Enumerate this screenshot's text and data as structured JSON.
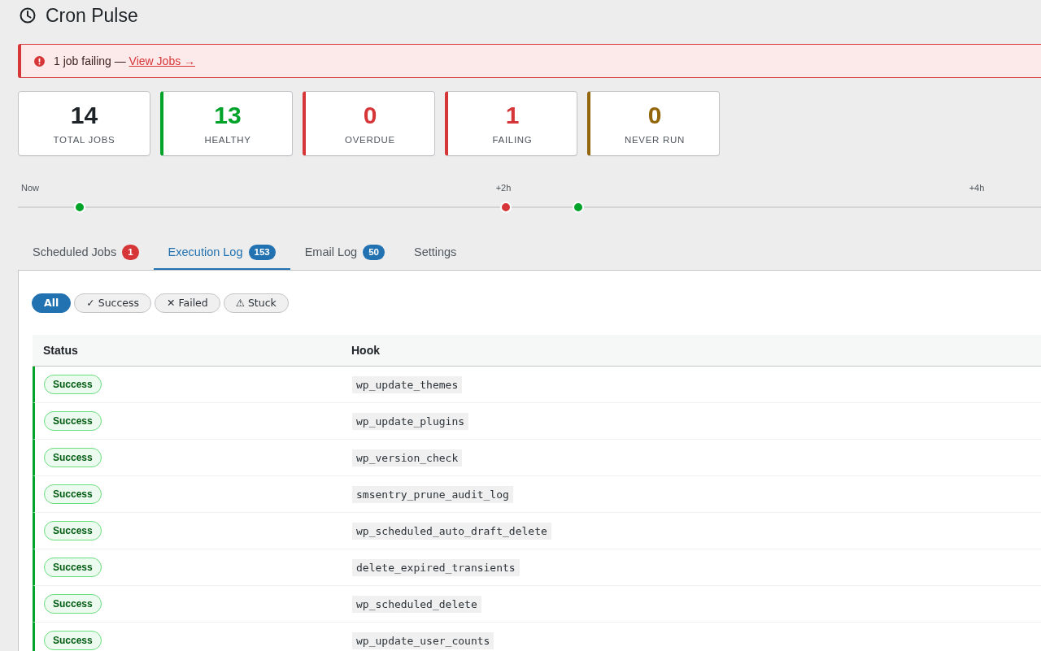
{
  "header": {
    "title": "Cron Pulse"
  },
  "alert": {
    "message": "1 job failing —",
    "link": "View Jobs →"
  },
  "stats": [
    {
      "value": "14",
      "label": "TOTAL JOBS"
    },
    {
      "value": "13",
      "label": "HEALTHY",
      "color": "#00a32a"
    },
    {
      "value": "0",
      "label": "OVERDUE",
      "color": "#d63638"
    },
    {
      "value": "1",
      "label": "FAILING",
      "color": "#d63638"
    },
    {
      "value": "0",
      "label": "NEVER RUN",
      "color": "#94660c"
    }
  ],
  "timeline": {
    "ticks": [
      "Now",
      "+2h",
      "+4h"
    ],
    "runs": [
      {
        "color": "#00a32a",
        "level": 0.059
      },
      {
        "color": "#d63638",
        "level": 0.463
      },
      {
        "color": "#00a32a",
        "level": 0.532
      }
    ]
  },
  "tabs": [
    {
      "label": "Scheduled Jobs",
      "badge": {
        "text": "1",
        "color": "#d63638"
      },
      "selected": false
    },
    {
      "label": "Execution Log",
      "badge": {
        "text": "153",
        "color": "#2271b1"
      },
      "selected": true
    },
    {
      "label": "Email Log",
      "badge": {
        "text": "50",
        "color": "#2271b1"
      },
      "selected": false
    },
    {
      "label": "Settings",
      "selected": false
    }
  ],
  "filters": [
    {
      "label": "All",
      "selected": true
    },
    {
      "label": "✓ Success",
      "selected": false
    },
    {
      "label": "✕ Failed",
      "selected": false
    },
    {
      "label": "⚠ Stuck",
      "selected": false
    }
  ],
  "log": {
    "columns": [
      "Status",
      "Hook"
    ],
    "rows": [
      {
        "status": "Success",
        "kind": "success",
        "hook": "wp_update_themes"
      },
      {
        "status": "Success",
        "kind": "success",
        "hook": "wp_update_plugins"
      },
      {
        "status": "Success",
        "kind": "success",
        "hook": "wp_version_check"
      },
      {
        "status": "Success",
        "kind": "success",
        "hook": "smsentry_prune_audit_log"
      },
      {
        "status": "Success",
        "kind": "success",
        "hook": "wp_scheduled_auto_draft_delete"
      },
      {
        "status": "Success",
        "kind": "success",
        "hook": "delete_expired_transients"
      },
      {
        "status": "Success",
        "kind": "success",
        "hook": "wp_scheduled_delete"
      },
      {
        "status": "Success",
        "kind": "success",
        "hook": "wp_update_user_counts"
      }
    ]
  }
}
